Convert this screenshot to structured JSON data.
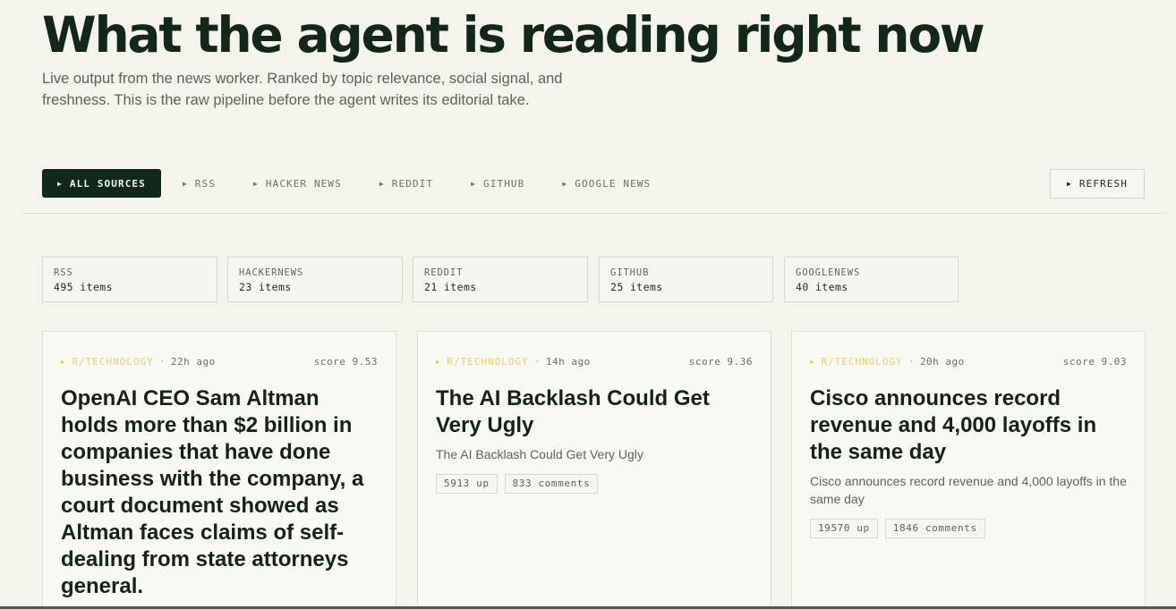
{
  "hero": {
    "title": "What the agent is reading right now",
    "subtitle": "Live output from the news worker. Ranked by topic relevance, social signal, and freshness. This is the raw pipeline before the agent writes its editorial take."
  },
  "filters": [
    {
      "label": "ALL SOURCES",
      "active": true
    },
    {
      "label": "RSS",
      "active": false
    },
    {
      "label": "HACKER NEWS",
      "active": false
    },
    {
      "label": "REDDIT",
      "active": false
    },
    {
      "label": "GITHUB",
      "active": false
    },
    {
      "label": "GOOGLE NEWS",
      "active": false
    }
  ],
  "refresh_label": "REFRESH",
  "stats": [
    {
      "label": "RSS",
      "count": "495 items"
    },
    {
      "label": "HACKERNEWS",
      "count": "23 items"
    },
    {
      "label": "REDDIT",
      "count": "21 items"
    },
    {
      "label": "GITHUB",
      "count": "25 items"
    },
    {
      "label": "GOOGLENEWS",
      "count": "40 items"
    }
  ],
  "cards": [
    {
      "source": "R/TECHNOLOGY",
      "age": "22h ago",
      "score": "score 9.53",
      "title": "OpenAI CEO Sam Altman holds more than $2 billion in companies that have done business with the company, a court document showed as Altman faces claims of self-dealing from state attorneys general.",
      "description": "",
      "upvotes": "",
      "comments": ""
    },
    {
      "source": "R/TECHNOLOGY",
      "age": "14h ago",
      "score": "score 9.36",
      "title": "The AI Backlash Could Get Very Ugly",
      "description": "The AI Backlash Could Get Very Ugly",
      "upvotes": "5913 up",
      "comments": "833 comments"
    },
    {
      "source": "R/TECHNOLOGY",
      "age": "20h ago",
      "score": "score 9.03",
      "title": "Cisco announces record revenue and 4,000 layoffs in the same day",
      "description": "Cisco announces record revenue and 4,000 layoffs in the same day",
      "upvotes": "19570 up",
      "comments": "1846 comments"
    }
  ],
  "colors": {
    "background": "#f4f3ec",
    "accent_dark": "#10271b",
    "source_yellow": "#e6cd6f"
  }
}
